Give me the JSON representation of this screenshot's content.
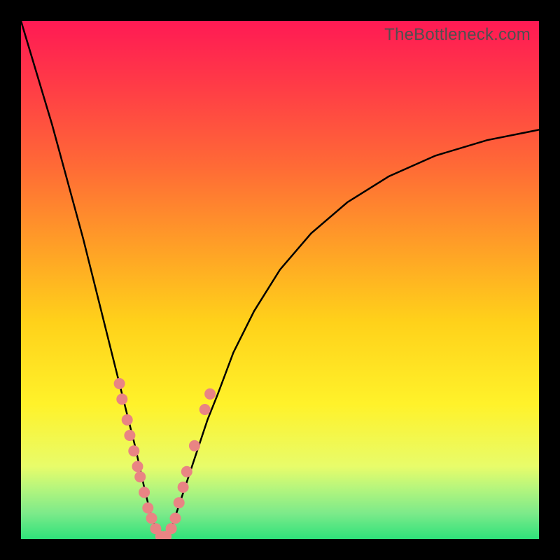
{
  "attribution": "TheBottleneck.com",
  "colors": {
    "frame": "#000000",
    "curve": "#000000",
    "dot": "#e98484",
    "gradient_top": "#ff1a54",
    "gradient_bottom": "#2fe27a"
  },
  "chart_data": {
    "type": "line",
    "title": "",
    "xlabel": "",
    "ylabel": "",
    "xlim": [
      0,
      100
    ],
    "ylim": [
      0,
      100
    ],
    "note": "Axes are unlabeled; x is horizontal position (0=left,100=right), y is vertical position (0=bottom,100=top). Curve is a V-shaped bottleneck curve with minimum near x≈27.",
    "series": [
      {
        "name": "bottleneck-curve",
        "x": [
          0,
          3,
          6,
          9,
          12,
          15,
          18,
          20,
          22,
          24,
          25,
          26,
          27,
          28,
          29,
          30,
          32,
          34,
          36,
          38,
          41,
          45,
          50,
          56,
          63,
          71,
          80,
          90,
          100
        ],
        "y": [
          100,
          90,
          80,
          69,
          58,
          46,
          34,
          26,
          18,
          9,
          5,
          2,
          0,
          1,
          2,
          5,
          11,
          17,
          23,
          28,
          36,
          44,
          52,
          59,
          65,
          70,
          74,
          77,
          79
        ]
      }
    ],
    "scatter": {
      "name": "sample-points",
      "note": "Pink dots clustered near the minimum of the curve on both branches.",
      "points": [
        {
          "x": 19.0,
          "y": 30
        },
        {
          "x": 19.5,
          "y": 27
        },
        {
          "x": 20.5,
          "y": 23
        },
        {
          "x": 21.0,
          "y": 20
        },
        {
          "x": 21.8,
          "y": 17
        },
        {
          "x": 22.5,
          "y": 14
        },
        {
          "x": 23.0,
          "y": 12
        },
        {
          "x": 23.8,
          "y": 9
        },
        {
          "x": 24.5,
          "y": 6
        },
        {
          "x": 25.2,
          "y": 4
        },
        {
          "x": 26.0,
          "y": 2
        },
        {
          "x": 27.0,
          "y": 0.5
        },
        {
          "x": 28.0,
          "y": 0.5
        },
        {
          "x": 29.0,
          "y": 2
        },
        {
          "x": 29.8,
          "y": 4
        },
        {
          "x": 30.5,
          "y": 7
        },
        {
          "x": 31.3,
          "y": 10
        },
        {
          "x": 32.0,
          "y": 13
        },
        {
          "x": 33.5,
          "y": 18
        },
        {
          "x": 35.5,
          "y": 25
        },
        {
          "x": 36.5,
          "y": 28
        }
      ]
    }
  }
}
